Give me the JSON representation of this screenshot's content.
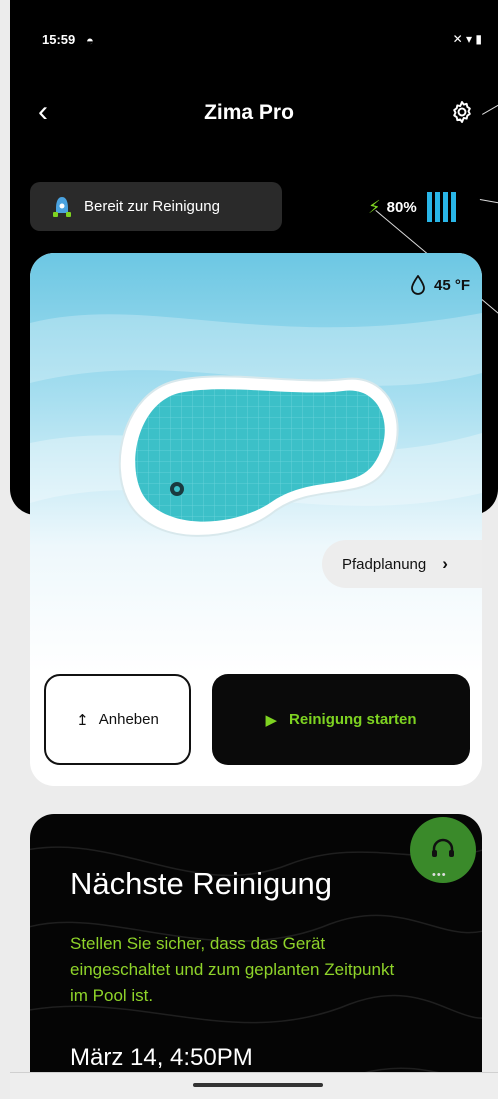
{
  "status_bar": {
    "time": "15:59",
    "camera_glyph": "◓",
    "right_icons": "✕ ▾ ▮"
  },
  "header": {
    "back_glyph": "‹",
    "title": "Zima Pro",
    "settings_icon": "gear-icon"
  },
  "device_status": {
    "label": "Bereit zur Reinigung",
    "icon": "robot-icon"
  },
  "battery": {
    "bolt": "⚡",
    "percent": "80%",
    "level_bars": 4,
    "color": "#29b6e8"
  },
  "pool": {
    "temperature": "45 °F",
    "path_planning": "Pfadplanung",
    "path_chevron": "›"
  },
  "actions": {
    "lift": "Anheben",
    "lift_glyph": "↥",
    "start": "Reinigung starten",
    "start_glyph": "▶"
  },
  "next_cleaning": {
    "title": "Nächste Reinigung",
    "description": "Stellen Sie sicher, dass das Gerät eingeschaltet und zum geplanten Zeitpunkt im Pool ist.",
    "datetime": "März 14, 4:50PM"
  },
  "support": {
    "dots": "•••"
  },
  "colors": {
    "accent_green": "#7ed321",
    "battery_blue": "#29b6e8",
    "pool_teal": "#3cc0c8",
    "background_dark": "#000000"
  }
}
